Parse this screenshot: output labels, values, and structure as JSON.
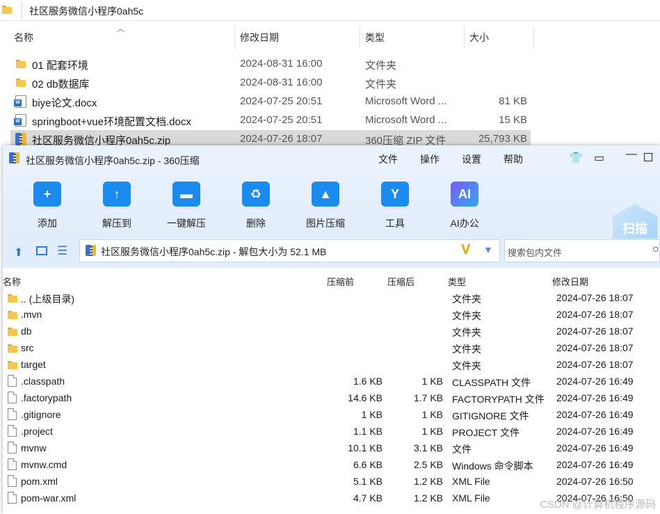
{
  "explorer": {
    "path": "社区服务微信小程序0ah5c",
    "columns": {
      "name": "名称",
      "modified": "修改日期",
      "type": "类型",
      "size": "大小"
    },
    "rows": [
      {
        "name": "01 配套环境",
        "date": "2024-08-31 16:00",
        "type": "文件夹",
        "size": "",
        "icon": "folder-icon"
      },
      {
        "name": "02 db数据库",
        "date": "2024-08-31 16:00",
        "type": "文件夹",
        "size": "",
        "icon": "folder-icon"
      },
      {
        "name": "biye论文.docx",
        "date": "2024-07-25 20:51",
        "type": "Microsoft Word ...",
        "size": "81 KB",
        "icon": "word-doc-icon"
      },
      {
        "name": "springboot+vue环境配置文档.docx",
        "date": "2024-07-25 20:51",
        "type": "Microsoft Word ...",
        "size": "15 KB",
        "icon": "word-doc-icon"
      },
      {
        "name": "社区服务微信小程序0ah5c.zip",
        "date": "2024-07-26 18:07",
        "type": "360压缩 ZIP 文件",
        "size": "25,793 KB",
        "icon": "zip-archive-icon",
        "selected": true
      }
    ]
  },
  "archiver": {
    "title": "社区服务微信小程序0ah5c.zip - 360压缩",
    "menu": [
      "文件",
      "操作",
      "设置",
      "帮助"
    ],
    "tools": [
      {
        "label": "添加",
        "icon": "add-icon"
      },
      {
        "label": "解压到",
        "icon": "extract-to-icon"
      },
      {
        "label": "一键解压",
        "icon": "one-click-extract-icon"
      },
      {
        "label": "删除",
        "icon": "delete-icon"
      },
      {
        "label": "图片压缩",
        "icon": "image-compress-icon"
      },
      {
        "label": "工具",
        "icon": "tools-icon"
      },
      {
        "label": "AI办公",
        "icon": "ai-office-icon"
      }
    ],
    "scan_label": "扫描",
    "address": "社区服务微信小程序0ah5c.zip - 解包大小为 52.1 MB",
    "search_placeholder": "搜索包内文件",
    "columns": {
      "name": "名称",
      "before": "压缩前",
      "after": "压缩后",
      "type": "类型",
      "date": "修改日期"
    },
    "rows": [
      {
        "name": ".. (上级目录)",
        "before": "",
        "after": "",
        "type": "文件夹",
        "date": "2024-07-26 18:07",
        "icon": "folder-icon"
      },
      {
        "name": ".mvn",
        "before": "",
        "after": "",
        "type": "文件夹",
        "date": "2024-07-26 18:07",
        "icon": "folder-icon"
      },
      {
        "name": "db",
        "before": "",
        "after": "",
        "type": "文件夹",
        "date": "2024-07-26 18:07",
        "icon": "folder-icon"
      },
      {
        "name": "src",
        "before": "",
        "after": "",
        "type": "文件夹",
        "date": "2024-07-26 18:07",
        "icon": "folder-icon"
      },
      {
        "name": "target",
        "before": "",
        "after": "",
        "type": "文件夹",
        "date": "2024-07-26 18:07",
        "icon": "folder-icon"
      },
      {
        "name": ".classpath",
        "before": "1.6 KB",
        "after": "1 KB",
        "type": "CLASSPATH 文件",
        "date": "2024-07-26 16:49",
        "icon": "file-icon"
      },
      {
        "name": ".factorypath",
        "before": "14.6 KB",
        "after": "1.7 KB",
        "type": "FACTORYPATH 文件",
        "date": "2024-07-26 16:49",
        "icon": "file-icon"
      },
      {
        "name": ".gitignore",
        "before": "1 KB",
        "after": "1 KB",
        "type": "GITIGNORE 文件",
        "date": "2024-07-26 16:49",
        "icon": "file-icon"
      },
      {
        "name": ".project",
        "before": "1.1 KB",
        "after": "1 KB",
        "type": "PROJECT 文件",
        "date": "2024-07-26 16:49",
        "icon": "file-icon"
      },
      {
        "name": "mvnw",
        "before": "10.1 KB",
        "after": "3.1 KB",
        "type": "文件",
        "date": "2024-07-26 16:49",
        "icon": "file-icon"
      },
      {
        "name": "mvnw.cmd",
        "before": "6.6 KB",
        "after": "2.5 KB",
        "type": "Windows 命令脚本",
        "date": "2024-07-26 16:49",
        "icon": "script-file-icon"
      },
      {
        "name": "pom.xml",
        "before": "5.1 KB",
        "after": "1.2 KB",
        "type": "XML File",
        "date": "2024-07-26 16:50",
        "icon": "file-icon"
      },
      {
        "name": "pom-war.xml",
        "before": "4.7 KB",
        "after": "1.2 KB",
        "type": "XML File",
        "date": "2024-07-26 16:50",
        "icon": "file-icon"
      }
    ]
  },
  "watermark": "CSDN @计算机程序源码"
}
